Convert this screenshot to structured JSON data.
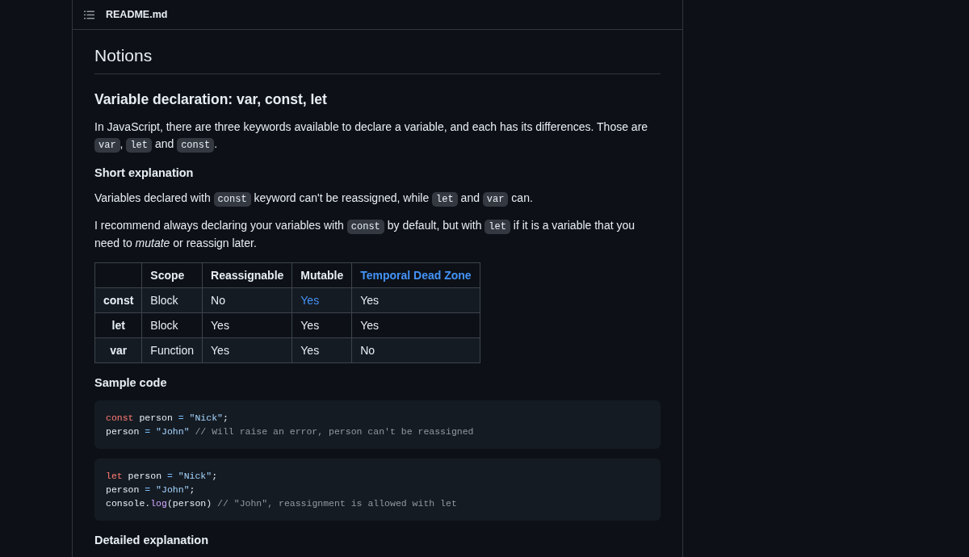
{
  "file_header": {
    "filename": "README.md"
  },
  "content": [
    {
      "kind": "h1",
      "text": "Notions"
    },
    {
      "kind": "h2",
      "text": "Variable declaration: var, const, let"
    },
    {
      "kind": "p",
      "segments": [
        {
          "kind": "text",
          "text": "In JavaScript, there are three keywords available to declare a variable, and each has its differences. Those are "
        },
        {
          "kind": "code",
          "text": "var"
        },
        {
          "kind": "text",
          "text": ", "
        },
        {
          "kind": "code",
          "text": "let"
        },
        {
          "kind": "text",
          "text": " and "
        },
        {
          "kind": "code",
          "text": "const"
        },
        {
          "kind": "text",
          "text": "."
        }
      ]
    },
    {
      "kind": "h4",
      "text": "Short explanation"
    },
    {
      "kind": "p",
      "segments": [
        {
          "kind": "text",
          "text": "Variables declared with "
        },
        {
          "kind": "code",
          "text": "const"
        },
        {
          "kind": "text",
          "text": " keyword can't be reassigned, while "
        },
        {
          "kind": "code",
          "text": "let"
        },
        {
          "kind": "text",
          "text": " and "
        },
        {
          "kind": "code",
          "text": "var"
        },
        {
          "kind": "text",
          "text": " can."
        }
      ]
    },
    {
      "kind": "p",
      "segments": [
        {
          "kind": "text",
          "text": "I recommend always declaring your variables with "
        },
        {
          "kind": "code",
          "text": "const"
        },
        {
          "kind": "text",
          "text": " by default, but with "
        },
        {
          "kind": "code",
          "text": "let"
        },
        {
          "kind": "text",
          "text": " if it is a variable that you need to "
        },
        {
          "kind": "em",
          "text": "mutate"
        },
        {
          "kind": "text",
          "text": " or reassign later."
        }
      ]
    },
    {
      "kind": "table",
      "columns": [
        {
          "text": "Scope",
          "link": false
        },
        {
          "text": "Reassignable",
          "link": false
        },
        {
          "text": "Mutable",
          "link": false
        },
        {
          "text": "Temporal Dead Zone",
          "link": true
        }
      ],
      "rows": [
        {
          "label": "const",
          "cells": [
            {
              "text": "Block",
              "link": false
            },
            {
              "text": "No",
              "link": false
            },
            {
              "text": "Yes",
              "link": true
            },
            {
              "text": "Yes",
              "link": false
            }
          ]
        },
        {
          "label": "let",
          "cells": [
            {
              "text": "Block",
              "link": false
            },
            {
              "text": "Yes",
              "link": false
            },
            {
              "text": "Yes",
              "link": false
            },
            {
              "text": "Yes",
              "link": false
            }
          ]
        },
        {
          "label": "var",
          "cells": [
            {
              "text": "Function",
              "link": false
            },
            {
              "text": "Yes",
              "link": false
            },
            {
              "text": "Yes",
              "link": false
            },
            {
              "text": "No",
              "link": false
            }
          ]
        }
      ]
    },
    {
      "kind": "h4",
      "text": "Sample code"
    },
    {
      "kind": "code",
      "lines": [
        [
          {
            "kind": "keyword",
            "text": "const"
          },
          {
            "kind": "plain",
            "text": " person "
          },
          {
            "kind": "operator",
            "text": "="
          },
          {
            "kind": "string",
            "text": " \"Nick\""
          },
          {
            "kind": "plain",
            "text": ";"
          }
        ],
        [
          {
            "kind": "plain",
            "text": "person "
          },
          {
            "kind": "operator",
            "text": "="
          },
          {
            "kind": "string",
            "text": " \"John\""
          },
          {
            "kind": "comment",
            "text": " // Will raise an error, person can't be reassigned"
          }
        ]
      ]
    },
    {
      "kind": "code",
      "lines": [
        [
          {
            "kind": "keyword",
            "text": "let"
          },
          {
            "kind": "plain",
            "text": " person "
          },
          {
            "kind": "operator",
            "text": "="
          },
          {
            "kind": "string",
            "text": " \"Nick\""
          },
          {
            "kind": "plain",
            "text": ";"
          }
        ],
        [
          {
            "kind": "plain",
            "text": "person "
          },
          {
            "kind": "operator",
            "text": "="
          },
          {
            "kind": "string",
            "text": " \"John\""
          },
          {
            "kind": "plain",
            "text": ";"
          }
        ],
        [
          {
            "kind": "plain",
            "text": "console."
          },
          {
            "kind": "function",
            "text": "log"
          },
          {
            "kind": "plain",
            "text": "(person) "
          },
          {
            "kind": "comment",
            "text": "// \"John\", reassignment is allowed with let"
          }
        ]
      ]
    },
    {
      "kind": "h4",
      "text": "Detailed explanation"
    }
  ]
}
